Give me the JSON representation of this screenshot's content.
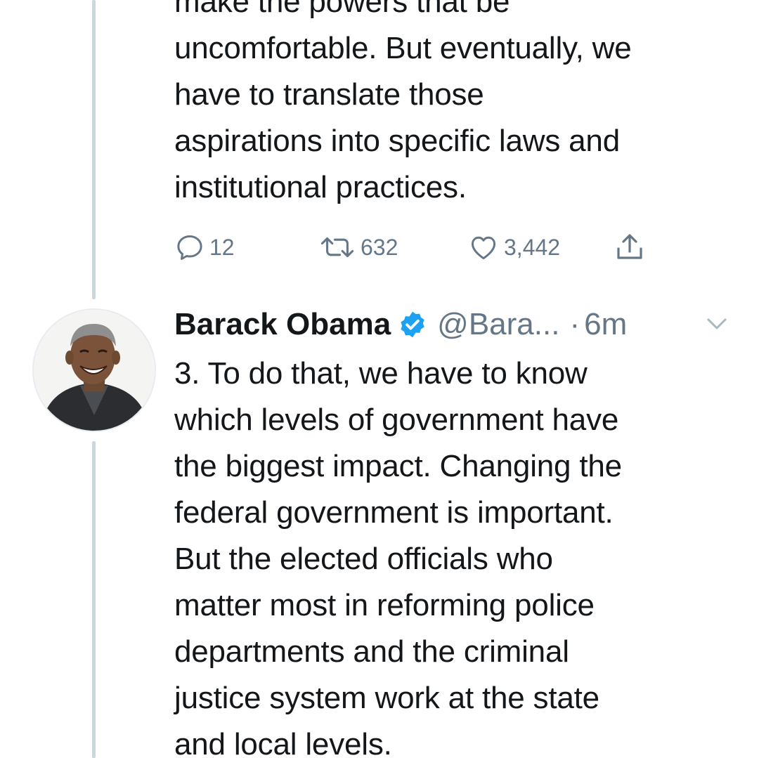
{
  "previous_tweet": {
    "lines": [
      "make the powers that be",
      "uncomfortable. But eventually, we",
      "have to translate those",
      "aspirations into specific laws and",
      "institutional practices."
    ],
    "actions": {
      "reply_count": "12",
      "retweet_count": "632",
      "like_count": "3,442"
    }
  },
  "tweet": {
    "author_name": "Barack Obama",
    "handle": "@Bara...",
    "separator": "·",
    "timestamp": "6m",
    "verified": true,
    "avatar_icon": "profile-photo",
    "lines": [
      "3. To do that, we have to know",
      "which levels of government have",
      "the biggest impact. Changing the",
      "federal government is important.",
      "But the elected officials who",
      "matter most in reforming police",
      "departments and the criminal",
      "justice system work at the state",
      "and local levels."
    ]
  },
  "colors": {
    "text": "#14171a",
    "secondary": "#657786",
    "verified_blue": "#1da1f2",
    "thread_line": "#ccd6dd"
  },
  "icons": {
    "reply": "reply-icon",
    "retweet": "retweet-icon",
    "like": "heart-icon",
    "share": "share-icon",
    "verified": "verified-badge-icon",
    "menu": "chevron-down-icon"
  }
}
